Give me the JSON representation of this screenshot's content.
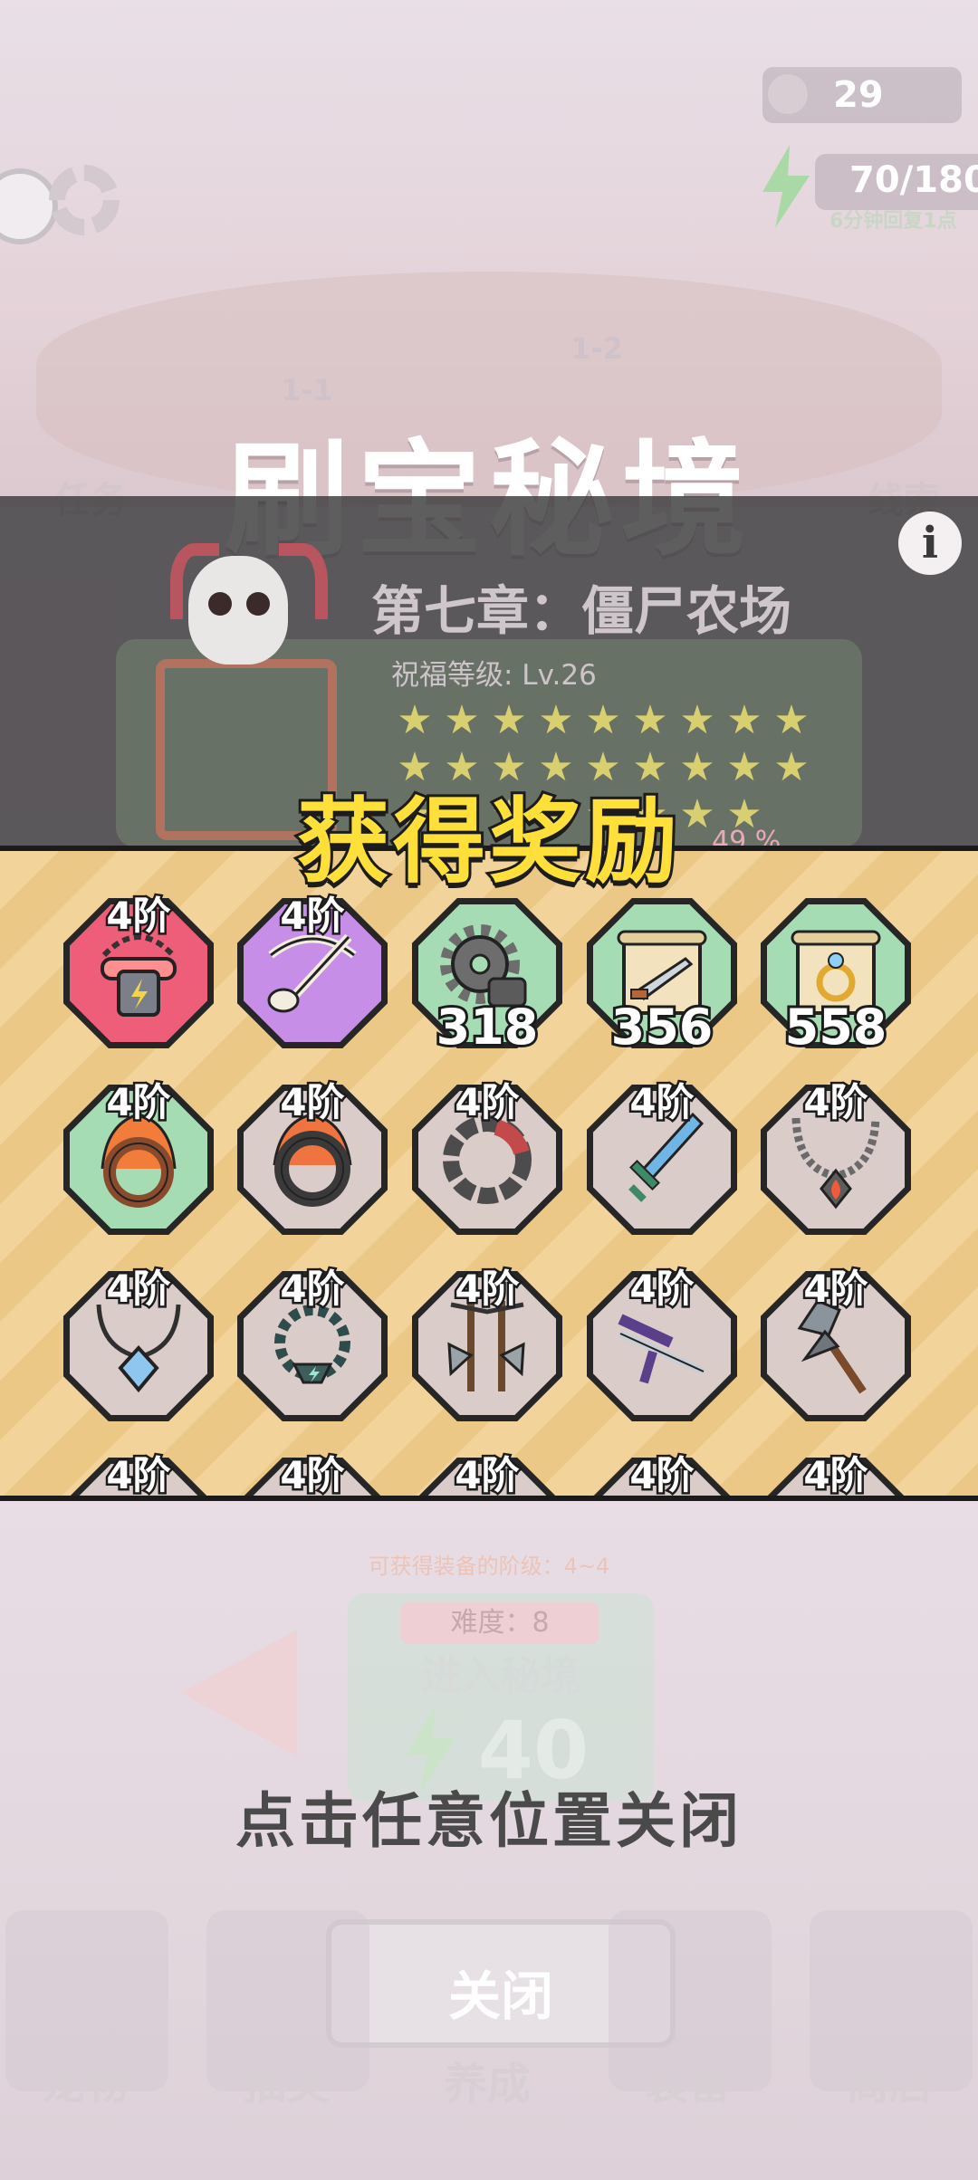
{
  "hud": {
    "gems": "29",
    "energy": "70/180",
    "energy_regen": "6分钟回复1点"
  },
  "map": {
    "level_a": "1-1",
    "level_b": "1-2",
    "left_side": "任务",
    "right_side": "线索"
  },
  "dungeon": {
    "title": "刷宝秘境",
    "chapter": "第七章：僵尸农场",
    "blessing_level": "祝福等级: Lv.26",
    "star_rows": [
      9,
      9,
      8
    ],
    "progress_text": "49 %"
  },
  "reward": {
    "title": "获得奖励",
    "items": [
      {
        "tier": "4阶",
        "bg": "red",
        "icon": "chain-amulet-icon",
        "count": ""
      },
      {
        "tier": "4阶",
        "bg": "purple",
        "icon": "bone-crossbow-icon",
        "count": ""
      },
      {
        "tier": "",
        "bg": "green",
        "icon": "gears-material-icon",
        "count": "318"
      },
      {
        "tier": "",
        "bg": "green",
        "icon": "weapon-scroll-icon",
        "count": "356"
      },
      {
        "tier": "",
        "bg": "green",
        "icon": "ring-scroll-icon",
        "count": "558"
      },
      {
        "tier": "4阶",
        "bg": "green",
        "icon": "flame-ring-icon",
        "count": ""
      },
      {
        "tier": "4阶",
        "bg": "gray",
        "icon": "black-flame-ring-icon",
        "count": ""
      },
      {
        "tier": "4阶",
        "bg": "gray",
        "icon": "mechanical-bracelet-icon",
        "count": ""
      },
      {
        "tier": "4阶",
        "bg": "gray",
        "icon": "ice-sword-icon",
        "count": ""
      },
      {
        "tier": "4阶",
        "bg": "gray",
        "icon": "fire-gem-necklace-icon",
        "count": ""
      },
      {
        "tier": "4阶",
        "bg": "gray",
        "icon": "crystal-necklace-icon",
        "count": ""
      },
      {
        "tier": "4阶",
        "bg": "gray",
        "icon": "thunder-necklace-icon",
        "count": ""
      },
      {
        "tier": "4阶",
        "bg": "gray",
        "icon": "twin-axes-icon",
        "count": ""
      },
      {
        "tier": "4阶",
        "bg": "gray",
        "icon": "katana-icon",
        "count": ""
      },
      {
        "tier": "4阶",
        "bg": "gray",
        "icon": "battle-axe-icon",
        "count": ""
      },
      {
        "tier": "4阶",
        "bg": "gray",
        "icon": "hidden-item-icon",
        "count": ""
      },
      {
        "tier": "4阶",
        "bg": "gray",
        "icon": "hidden-item-icon",
        "count": ""
      },
      {
        "tier": "4阶",
        "bg": "gray",
        "icon": "hidden-item-icon",
        "count": ""
      },
      {
        "tier": "4阶",
        "bg": "gray",
        "icon": "hidden-item-icon",
        "count": ""
      },
      {
        "tier": "4阶",
        "bg": "gray",
        "icon": "hidden-item-icon",
        "count": ""
      }
    ],
    "close_hint": "点击任意位置关闭"
  },
  "entry": {
    "obtainable_levels": "可获得装备的阶级：4~4",
    "difficulty": "难度：8",
    "enter_label": "进入秘境",
    "energy_cost": "40",
    "close_button": "关闭"
  },
  "bottom_nav": [
    "宠物",
    "抽奖",
    "养成",
    "装备",
    "商店"
  ],
  "colors": {
    "banner_yellow": "#ffdf3a",
    "banner_stripe_a": "#f2d39a",
    "banner_stripe_b": "#ecc887",
    "red_rarity": "#ef5e78",
    "purple_rarity": "#c68ee6",
    "green_rarity": "#a5dcb3",
    "gray_rarity": "#d9ccc9"
  }
}
